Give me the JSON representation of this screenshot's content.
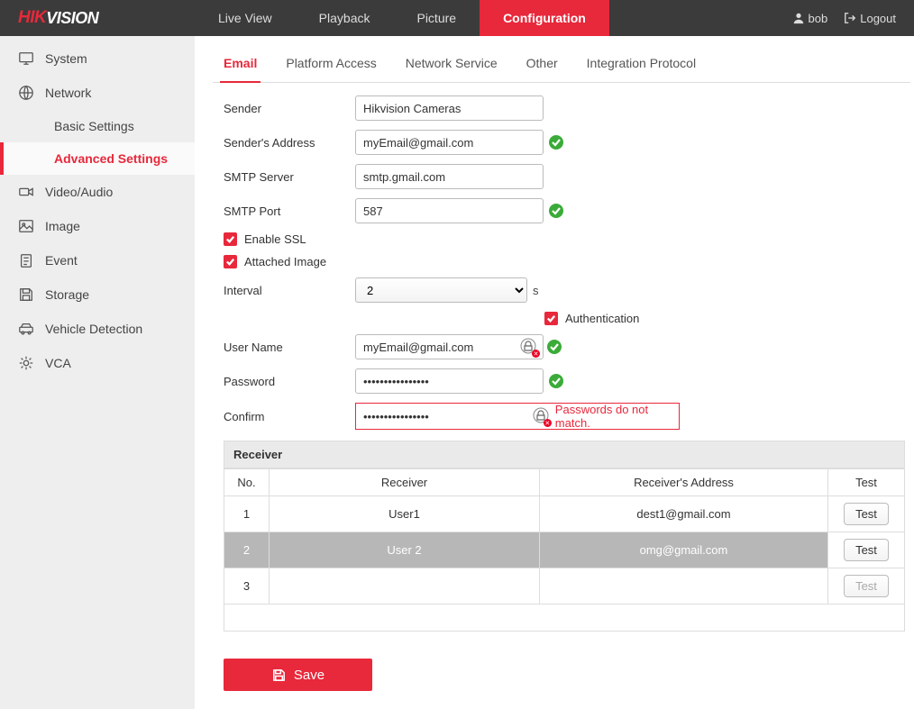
{
  "brand": {
    "part1": "HIK",
    "part2": "VISION"
  },
  "topnav": {
    "items": [
      {
        "label": "Live View"
      },
      {
        "label": "Playback"
      },
      {
        "label": "Picture"
      },
      {
        "label": "Configuration"
      }
    ],
    "user": "bob",
    "logout": "Logout"
  },
  "sidebar": {
    "items": [
      {
        "label": "System",
        "icon": "monitor-icon"
      },
      {
        "label": "Network",
        "icon": "globe-icon"
      },
      {
        "label": "Basic Settings",
        "sub": true
      },
      {
        "label": "Advanced Settings",
        "sub": true,
        "active": true
      },
      {
        "label": "Video/Audio",
        "icon": "camera-icon"
      },
      {
        "label": "Image",
        "icon": "image-icon"
      },
      {
        "label": "Event",
        "icon": "clipboard-icon"
      },
      {
        "label": "Storage",
        "icon": "save-icon"
      },
      {
        "label": "Vehicle Detection",
        "icon": "vehicle-icon"
      },
      {
        "label": "VCA",
        "icon": "gear-icon"
      }
    ]
  },
  "subtabs": [
    {
      "label": "Email",
      "active": true
    },
    {
      "label": "Platform Access"
    },
    {
      "label": "Network Service"
    },
    {
      "label": "Other"
    },
    {
      "label": "Integration Protocol"
    }
  ],
  "form": {
    "sender_label": "Sender",
    "sender_value": "Hikvision Cameras",
    "sender_addr_label": "Sender's Address",
    "sender_addr_value": "myEmail@gmail.com",
    "smtp_server_label": "SMTP Server",
    "smtp_server_value": "smtp.gmail.com",
    "smtp_port_label": "SMTP Port",
    "smtp_port_value": "587",
    "enable_ssl_label": "Enable SSL",
    "attached_image_label": "Attached Image",
    "interval_label": "Interval",
    "interval_value": "2",
    "interval_unit": "s",
    "authentication_label": "Authentication",
    "username_label": "User Name",
    "username_value": "myEmail@gmail.com",
    "password_label": "Password",
    "password_value": "••••••••••••••••",
    "confirm_label": "Confirm",
    "confirm_value": "••••••••••••••••",
    "confirm_error": "Passwords do not match."
  },
  "receiver": {
    "title": "Receiver",
    "headers": {
      "no": "No.",
      "name": "Receiver",
      "addr": "Receiver's Address",
      "test": "Test"
    },
    "rows": [
      {
        "no": "1",
        "name": "User1",
        "addr": "dest1@gmail.com",
        "test": "Test",
        "selected": false
      },
      {
        "no": "2",
        "name": "User 2",
        "addr": "omg@gmail.com",
        "test": "Test",
        "selected": true
      },
      {
        "no": "3",
        "name": "",
        "addr": "",
        "test": "Test",
        "selected": false,
        "disabled": true
      }
    ]
  },
  "save_label": "Save"
}
